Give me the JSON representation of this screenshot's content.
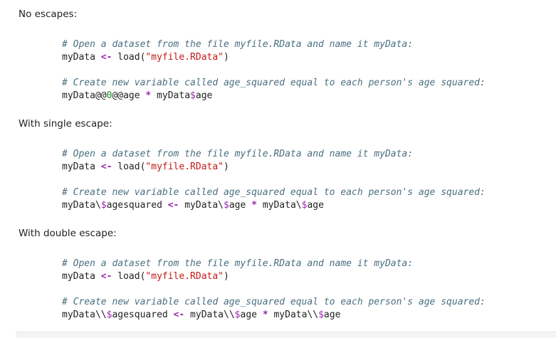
{
  "sections": [
    {
      "label": "No escapes:",
      "comment1": "# Open a dataset from the file myfile.RData and name it myData:",
      "line1": {
        "var": "myData",
        "op": "<-",
        "func": "load(",
        "str": "\"myfile.RData\"",
        "close": ")"
      },
      "comment2": "# Create new variable called age_squared equal to each person's age squared:",
      "line2": {
        "p1": "myData@@",
        "num": "0",
        "p2": "@@age",
        "op": "*",
        "p3": "myData",
        "dollar": "$",
        "p4": "age"
      }
    },
    {
      "label": "With single escape:",
      "comment1": "# Open a dataset from the file myfile.RData and name it myData:",
      "line1": {
        "var": "myData",
        "op": "<-",
        "func": "load(",
        "str": "\"myfile.RData\"",
        "close": ")"
      },
      "comment2": "# Create new variable called age_squared equal to each person's age squared:",
      "line2": {
        "a": "myData\\",
        "d1": "$",
        "b": "agesquared",
        "op1": "<-",
        "c": "myData\\",
        "d2": "$",
        "e": "age",
        "op2": "*",
        "f": "myData\\",
        "d3": "$",
        "g": "age"
      }
    },
    {
      "label": "With double escape:",
      "comment1": "# Open a dataset from the file myfile.RData and name it myData:",
      "line1": {
        "var": "myData",
        "op": "<-",
        "func": "load(",
        "str": "\"myfile.RData\"",
        "close": ")"
      },
      "comment2": "# Create new variable called age_squared equal to each person's age squared:",
      "line2": {
        "a": "myData\\\\",
        "d1": "$",
        "b": "agesquared",
        "op1": "<-",
        "c": "myData\\\\",
        "d2": "$",
        "e": "age",
        "op2": "*",
        "f": "myData\\\\",
        "d3": "$",
        "g": "age"
      }
    }
  ],
  "colors": {
    "comment": "#4a6f80",
    "operator": "#9c27b0",
    "string": "#c41a16",
    "number": "#1c8a1c"
  }
}
